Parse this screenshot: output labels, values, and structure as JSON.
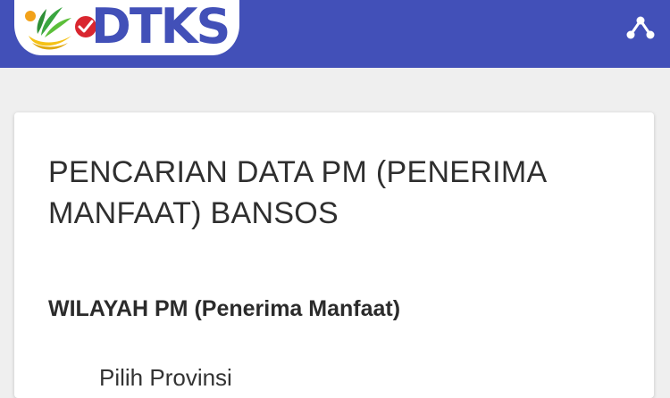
{
  "header": {
    "logo_text": "DTKS",
    "background_color": "#4250b8",
    "share_icon": "share-icon"
  },
  "card": {
    "title_line1": "PENCARIAN DATA PM (PENERIMA",
    "title_line2": "MANFAAT) BANSOS",
    "section_label": "WILAYAH PM (Penerima Manfaat)",
    "province_select_text": "Pilih Provinsi"
  }
}
